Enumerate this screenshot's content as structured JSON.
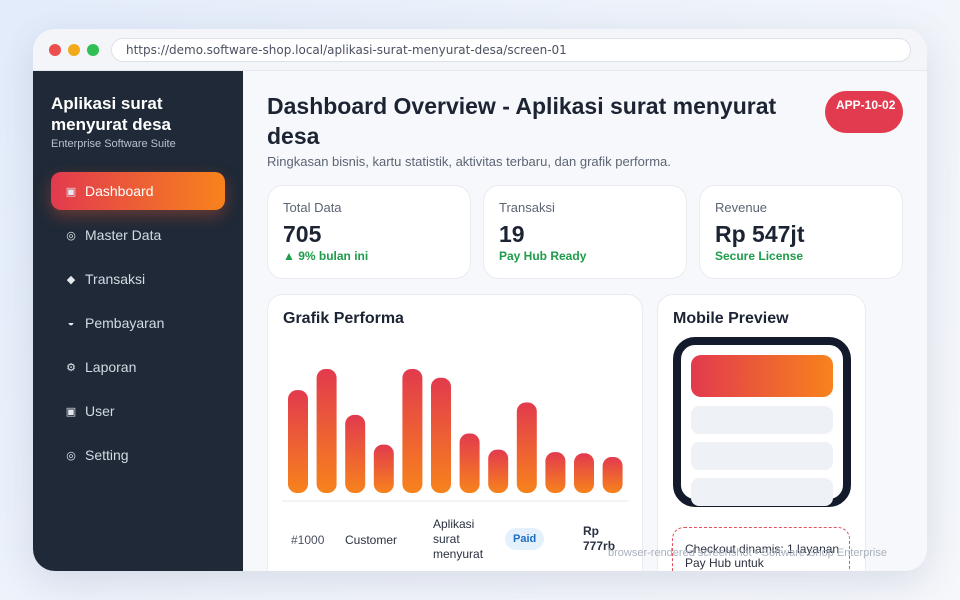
{
  "browser": {
    "url": "https://demo.software-shop.local/aplikasi-surat-menyurat-desa/screen-01"
  },
  "sidebar": {
    "brand_title": "Aplikasi surat menyurat desa",
    "brand_subtitle": "Enterprise Software Suite",
    "items": [
      {
        "label": "Dashboard",
        "icon": "▣",
        "icon_name": "dashboard-icon",
        "active": true
      },
      {
        "label": "Master Data",
        "icon": "◎",
        "icon_name": "database-icon",
        "active": false
      },
      {
        "label": "Transaksi",
        "icon": "◆",
        "icon_name": "transaction-icon",
        "active": false
      },
      {
        "label": "Pembayaran",
        "icon": "◒",
        "icon_name": "payment-icon",
        "active": false
      },
      {
        "label": "Laporan",
        "icon": "⚙",
        "icon_name": "report-icon",
        "active": false
      },
      {
        "label": "User",
        "icon": "▣",
        "icon_name": "user-icon",
        "active": false
      },
      {
        "label": "Setting",
        "icon": "◎",
        "icon_name": "settings-icon",
        "active": false
      }
    ]
  },
  "header": {
    "title": "Dashboard Overview - Aplikasi surat menyurat desa",
    "subtitle": "Ringkasan bisnis, kartu statistik, aktivitas terbaru, dan grafik performa.",
    "badge": "APP-10-02"
  },
  "stats": [
    {
      "label": "Total Data",
      "value": "705",
      "note": "▲ 9% bulan ini"
    },
    {
      "label": "Transaksi",
      "value": "19",
      "note": "Pay Hub Ready"
    },
    {
      "label": "Revenue",
      "value": "Rp 547jt",
      "note": "Secure License"
    }
  ],
  "chart": {
    "title": "Grafik Performa"
  },
  "chart_data": {
    "type": "bar",
    "title": "Grafik Performa",
    "xlabel": "",
    "ylabel": "",
    "ylim": [
      0,
      100
    ],
    "values": [
      83,
      100,
      63,
      39,
      100,
      93,
      48,
      35,
      73,
      33,
      32,
      29
    ]
  },
  "table_row": {
    "id": "#1000",
    "customer": "Customer",
    "product": "Aplikasi surat menyurat",
    "status": "Paid",
    "amount": "Rp 777rb"
  },
  "mobile": {
    "title": "Mobile Preview",
    "checkout_text": "Checkout dinamis: 1 layanan Pay Hub untuk"
  },
  "footer": "browser-rendered screenshot • Software Shop Enterprise",
  "colors": {
    "accent_start": "#e23a4e",
    "accent_end": "#f7831c",
    "sidebar": "#1f2937",
    "success": "#1e9c4a"
  }
}
